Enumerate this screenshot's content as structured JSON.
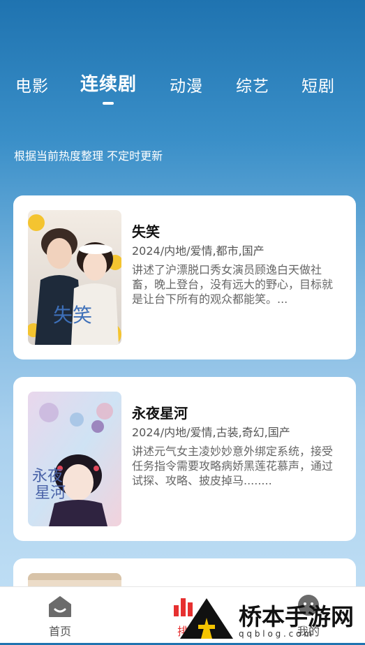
{
  "tabs": [
    {
      "label": "电影"
    },
    {
      "label": "连续剧"
    },
    {
      "label": "动漫"
    },
    {
      "label": "综艺"
    },
    {
      "label": "短剧"
    }
  ],
  "active_tab": "连续剧",
  "subtitle": "根据当前热度整理 不定时更新",
  "cards": [
    {
      "title": "失笑",
      "meta": "2024/内地/爱情,都市,国产",
      "desc": "讲述了沪漂脱口秀女演员顾逸白天做社畜，晚上登台，没有远大的野心，目标就是让台下所有的观众都能笑。..."
    },
    {
      "title": "永夜星河",
      "meta": "2024/内地/爱情,古装,奇幻,国产",
      "desc": "讲述元气女主凌妙妙意外绑定系统，接受任务指令需要攻略病娇黑莲花慕声，通过试探、攻略、披皮掉马........"
    }
  ],
  "nav": {
    "home_label": "首页",
    "rank_label": "排",
    "mine_label": "我的"
  },
  "watermark": {
    "brand": "桥本手游网",
    "domain": "q q b l o g . c o m"
  },
  "colors": {
    "accent_rank": "#e63030",
    "nav_icon": "#666666"
  }
}
